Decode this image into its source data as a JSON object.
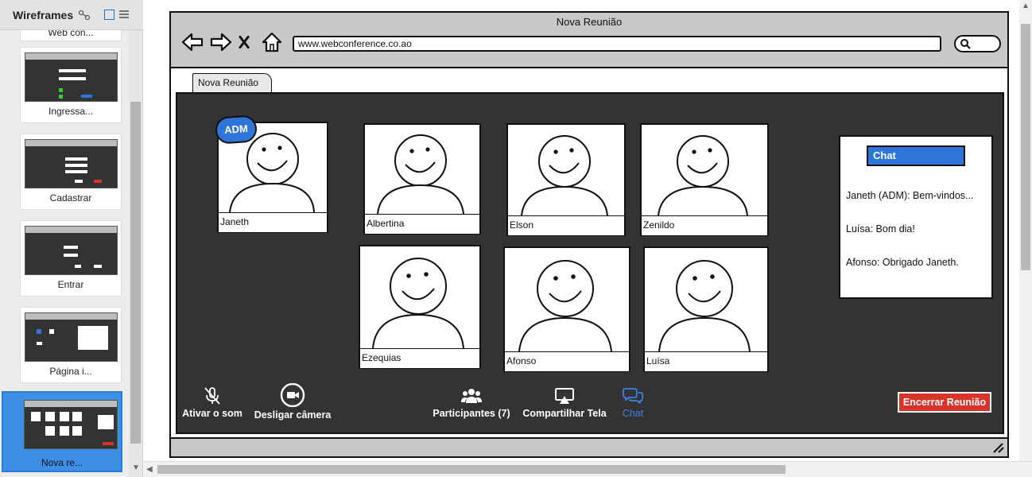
{
  "panel": {
    "title": "Wireframes",
    "pages": [
      {
        "label": "Web con..."
      },
      {
        "label": "Ingressa..."
      },
      {
        "label": "Cadastrar"
      },
      {
        "label": "Entrar"
      },
      {
        "label": "Página i..."
      },
      {
        "label": "Nova re...",
        "active": true
      }
    ]
  },
  "browser": {
    "title": "Nova Reunião",
    "url": "www.webconference.co.ao",
    "tab": "Nova Reunião"
  },
  "meeting": {
    "admin_badge": "ADM",
    "participants": [
      {
        "name": "Janeth"
      },
      {
        "name": "Albertina"
      },
      {
        "name": "Elson"
      },
      {
        "name": "Zenildo"
      },
      {
        "name": "Ezequias"
      },
      {
        "name": "Afonso"
      },
      {
        "name": "Luísa"
      }
    ]
  },
  "chat": {
    "header": "Chat",
    "messages": [
      "Janeth (ADM): Bem-vindos...",
      "Luísa: Bom dia!",
      "Afonso: Obrigado Janeth."
    ]
  },
  "controls": {
    "mute": "Ativar o som",
    "camera": "Desligar câmera",
    "participants": "Participantes (7)",
    "share": "Compartilhar Tela",
    "chat": "Chat",
    "end": "Encerrar Reunião"
  },
  "colors": {
    "accent": "#2f74d8",
    "stage": "#333333",
    "danger": "#d9342b",
    "chrome": "#c8c8c8"
  }
}
